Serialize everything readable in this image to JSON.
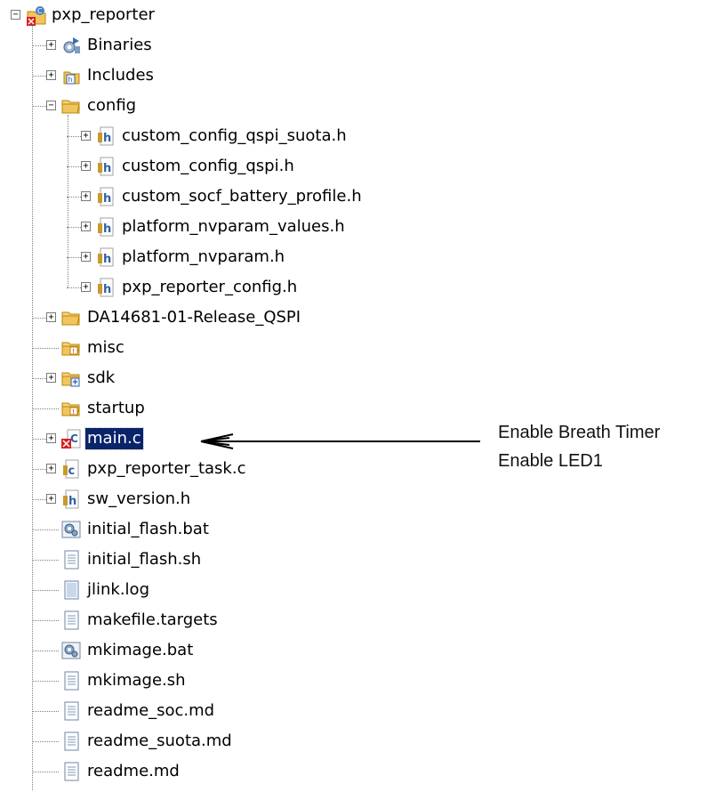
{
  "tree": {
    "items": [
      {
        "label": "pxp_reporter",
        "icon": "project-c-error-icon",
        "level": 0,
        "expander": "minus"
      },
      {
        "label": "Binaries",
        "icon": "binaries-icon",
        "level": 1,
        "expander": "plus"
      },
      {
        "label": "Includes",
        "icon": "includes-icon",
        "level": 1,
        "expander": "plus"
      },
      {
        "label": "config",
        "icon": "folder-open-icon",
        "level": 1,
        "expander": "minus"
      },
      {
        "label": "custom_config_qspi_suota.h",
        "icon": "header-file-icon",
        "level": 2,
        "expander": "plus"
      },
      {
        "label": "custom_config_qspi.h",
        "icon": "header-file-icon",
        "level": 2,
        "expander": "plus"
      },
      {
        "label": "custom_socf_battery_profile.h",
        "icon": "header-file-icon",
        "level": 2,
        "expander": "plus"
      },
      {
        "label": "platform_nvparam_values.h",
        "icon": "header-file-icon",
        "level": 2,
        "expander": "plus"
      },
      {
        "label": "platform_nvparam.h",
        "icon": "header-file-icon",
        "level": 2,
        "expander": "plus"
      },
      {
        "label": "pxp_reporter_config.h",
        "icon": "header-file-icon",
        "level": 2,
        "expander": "plus"
      },
      {
        "label": "DA14681-01-Release_QSPI",
        "icon": "folder-open-icon",
        "level": 1,
        "expander": "plus"
      },
      {
        "label": "misc",
        "icon": "linked-folder-icon",
        "level": 1,
        "expander": "none"
      },
      {
        "label": "sdk",
        "icon": "source-folder-icon",
        "level": 1,
        "expander": "plus"
      },
      {
        "label": "startup",
        "icon": "linked-folder-icon",
        "level": 1,
        "expander": "none"
      },
      {
        "label": "main.c",
        "icon": "c-file-error-icon",
        "level": 1,
        "expander": "plus",
        "selected": true
      },
      {
        "label": "pxp_reporter_task.c",
        "icon": "c-file-icon",
        "level": 1,
        "expander": "plus"
      },
      {
        "label": "sw_version.h",
        "icon": "header-file-icon",
        "level": 1,
        "expander": "plus"
      },
      {
        "label": "initial_flash.bat",
        "icon": "batch-file-icon",
        "level": 1,
        "expander": "none"
      },
      {
        "label": "initial_flash.sh",
        "icon": "text-file-icon",
        "level": 1,
        "expander": "none"
      },
      {
        "label": "jlink.log",
        "icon": "log-file-icon",
        "level": 1,
        "expander": "none"
      },
      {
        "label": "makefile.targets",
        "icon": "text-file-icon",
        "level": 1,
        "expander": "none"
      },
      {
        "label": "mkimage.bat",
        "icon": "batch-file-icon",
        "level": 1,
        "expander": "none"
      },
      {
        "label": "mkimage.sh",
        "icon": "text-file-icon",
        "level": 1,
        "expander": "none"
      },
      {
        "label": "readme_soc.md",
        "icon": "text-file-icon",
        "level": 1,
        "expander": "none"
      },
      {
        "label": "readme_suota.md",
        "icon": "text-file-icon",
        "level": 1,
        "expander": "none"
      },
      {
        "label": "readme.md",
        "icon": "text-file-icon",
        "level": 1,
        "expander": "none"
      }
    ]
  },
  "annotation": {
    "line1": "Enable Breath Timer",
    "line2": "Enable LED1"
  },
  "colors": {
    "selection": "#0a246a",
    "folder": "#f2c55c",
    "header_icon": "#2f5fa8",
    "error": "#d42020"
  }
}
